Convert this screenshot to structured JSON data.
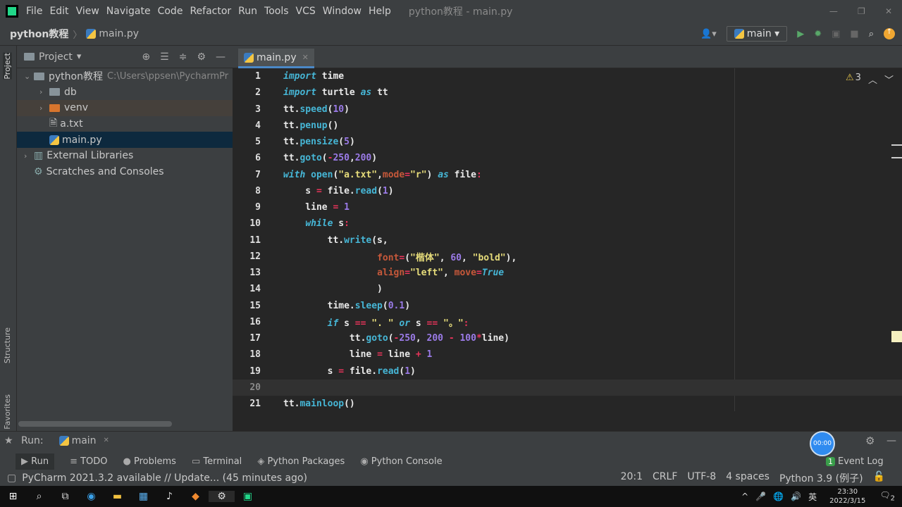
{
  "menu": {
    "items": [
      "File",
      "Edit",
      "View",
      "Navigate",
      "Code",
      "Refactor",
      "Run",
      "Tools",
      "VCS",
      "Window",
      "Help"
    ],
    "title": "python教程 - main.py"
  },
  "nav": {
    "project": "python教程",
    "file": "main.py",
    "run_config": "main"
  },
  "project_panel": {
    "title": "Project",
    "tree": [
      {
        "label": "python教程",
        "extra": "C:\\Users\\ppsen\\PycharmPr",
        "type": "folder",
        "depth": 0,
        "open": true
      },
      {
        "label": "db",
        "type": "folder",
        "depth": 1
      },
      {
        "label": "venv",
        "type": "folder-orange",
        "depth": 1
      },
      {
        "label": "a.txt",
        "type": "file",
        "depth": 1
      },
      {
        "label": "main.py",
        "type": "py",
        "depth": 1,
        "selected": true
      },
      {
        "label": "External Libraries",
        "type": "lib",
        "depth": 0
      },
      {
        "label": "Scratches and Consoles",
        "type": "scratch",
        "depth": 0
      }
    ]
  },
  "side_tabs": {
    "project": "Project",
    "structure": "Structure",
    "favorites": "Favorites"
  },
  "editor": {
    "tab": "main.py",
    "warnings": "3",
    "current_line": 20,
    "lines": [
      [
        [
          "k",
          "import"
        ],
        [
          "t",
          " time"
        ]
      ],
      [
        [
          "k",
          "import"
        ],
        [
          "t",
          " turtle "
        ],
        [
          "k",
          "as"
        ],
        [
          "t",
          " tt"
        ]
      ],
      [
        [
          "t",
          "tt."
        ],
        [
          "f",
          "speed"
        ],
        [
          "t",
          "("
        ],
        [
          "n",
          "10"
        ],
        [
          "t",
          ")"
        ]
      ],
      [
        [
          "t",
          "tt."
        ],
        [
          "f",
          "penup"
        ],
        [
          "t",
          "()"
        ]
      ],
      [
        [
          "t",
          "tt."
        ],
        [
          "f",
          "pensize"
        ],
        [
          "t",
          "("
        ],
        [
          "n",
          "5"
        ],
        [
          "t",
          ")"
        ]
      ],
      [
        [
          "t",
          "tt."
        ],
        [
          "f",
          "goto"
        ],
        [
          "t",
          "("
        ],
        [
          "o",
          "-"
        ],
        [
          "n",
          "250"
        ],
        [
          "t",
          ","
        ],
        [
          "n",
          "200"
        ],
        [
          "t",
          ")"
        ]
      ],
      [
        [
          "k",
          "with"
        ],
        [
          "t",
          " "
        ],
        [
          "f",
          "open"
        ],
        [
          "t",
          "("
        ],
        [
          "s",
          "\"a.txt\""
        ],
        [
          "t",
          ","
        ],
        [
          "p",
          "mode"
        ],
        [
          "o",
          "="
        ],
        [
          "s",
          "\"r\""
        ],
        [
          "t",
          ") "
        ],
        [
          "k",
          "as"
        ],
        [
          "t",
          " file"
        ],
        [
          "o",
          ":"
        ]
      ],
      [
        [
          "t",
          "    s "
        ],
        [
          "o",
          "="
        ],
        [
          "t",
          " file."
        ],
        [
          "f",
          "read"
        ],
        [
          "t",
          "("
        ],
        [
          "n",
          "1"
        ],
        [
          "t",
          ")"
        ]
      ],
      [
        [
          "t",
          "    line "
        ],
        [
          "o",
          "="
        ],
        [
          "t",
          " "
        ],
        [
          "n",
          "1"
        ]
      ],
      [
        [
          "t",
          "    "
        ],
        [
          "k",
          "while"
        ],
        [
          "t",
          " s"
        ],
        [
          "o",
          ":"
        ]
      ],
      [
        [
          "t",
          "        tt."
        ],
        [
          "f",
          "write"
        ],
        [
          "t",
          "(s,"
        ]
      ],
      [
        [
          "t",
          "                 "
        ],
        [
          "p",
          "font"
        ],
        [
          "o",
          "="
        ],
        [
          "t",
          "("
        ],
        [
          "s",
          "\"楷体\""
        ],
        [
          "t",
          ", "
        ],
        [
          "n",
          "60"
        ],
        [
          "t",
          ", "
        ],
        [
          "s",
          "\"bold\""
        ],
        [
          "t",
          "),"
        ]
      ],
      [
        [
          "t",
          "                 "
        ],
        [
          "p",
          "align"
        ],
        [
          "o",
          "="
        ],
        [
          "s",
          "\"left\""
        ],
        [
          "t",
          ", "
        ],
        [
          "p",
          "move"
        ],
        [
          "o",
          "="
        ],
        [
          "k",
          "True"
        ]
      ],
      [
        [
          "t",
          "                 )"
        ]
      ],
      [
        [
          "t",
          "        time."
        ],
        [
          "f",
          "sleep"
        ],
        [
          "t",
          "("
        ],
        [
          "n",
          "0.1"
        ],
        [
          "t",
          ")"
        ]
      ],
      [
        [
          "t",
          "        "
        ],
        [
          "k",
          "if"
        ],
        [
          "t",
          " s "
        ],
        [
          "o",
          "=="
        ],
        [
          "t",
          " "
        ],
        [
          "s",
          "\". \""
        ],
        [
          "t",
          " "
        ],
        [
          "k",
          "or"
        ],
        [
          "t",
          " s "
        ],
        [
          "o",
          "=="
        ],
        [
          "t",
          " "
        ],
        [
          "s",
          "\"。\""
        ],
        [
          "o",
          ":"
        ]
      ],
      [
        [
          "t",
          "            tt."
        ],
        [
          "f",
          "goto"
        ],
        [
          "t",
          "("
        ],
        [
          "o",
          "-"
        ],
        [
          "n",
          "250"
        ],
        [
          "t",
          ", "
        ],
        [
          "n",
          "200"
        ],
        [
          "t",
          " "
        ],
        [
          "o",
          "-"
        ],
        [
          "t",
          " "
        ],
        [
          "n",
          "100"
        ],
        [
          "o",
          "*"
        ],
        [
          "t",
          "line)"
        ]
      ],
      [
        [
          "t",
          "            line "
        ],
        [
          "o",
          "="
        ],
        [
          "t",
          " line "
        ],
        [
          "o",
          "+"
        ],
        [
          "t",
          " "
        ],
        [
          "n",
          "1"
        ]
      ],
      [
        [
          "t",
          "        s "
        ],
        [
          "o",
          "="
        ],
        [
          "t",
          " file."
        ],
        [
          "f",
          "read"
        ],
        [
          "t",
          "("
        ],
        [
          "n",
          "1"
        ],
        [
          "t",
          ")"
        ]
      ],
      [],
      [
        [
          "t",
          "tt."
        ],
        [
          "f",
          "mainloop"
        ],
        [
          "t",
          "()"
        ]
      ]
    ]
  },
  "run_bar": {
    "label": "Run:",
    "tab": "main",
    "timer": "00:00"
  },
  "bottom_tabs": [
    "Run",
    "TODO",
    "Problems",
    "Terminal",
    "Python Packages",
    "Python Console"
  ],
  "event_log": {
    "count": "1",
    "label": "Event Log"
  },
  "status": {
    "message": "PyCharm 2021.3.2 available // Update... (45 minutes ago)",
    "position": "20:1",
    "line_sep": "CRLF",
    "encoding": "UTF-8",
    "indent": "4 spaces",
    "interpreter": "Python 3.9 (例子)"
  },
  "taskbar": {
    "time": "23:30",
    "date": "2022/3/15",
    "ime": "英",
    "notifications": "2"
  }
}
